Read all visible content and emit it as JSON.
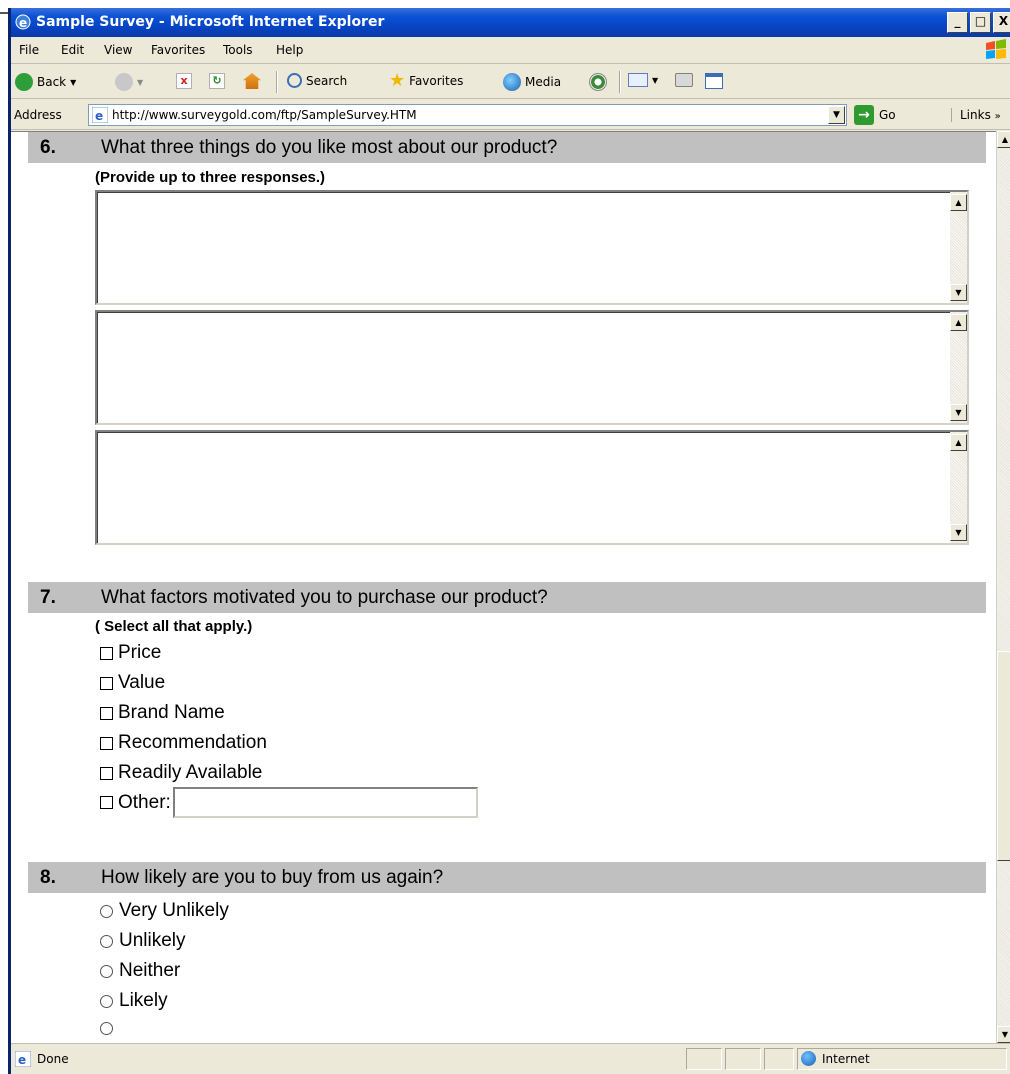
{
  "window": {
    "title": "Sample Survey - Microsoft Internet Explorer",
    "minimize": "_",
    "restore": "□",
    "close": "X"
  },
  "menu": [
    "File",
    "Edit",
    "View",
    "Favorites",
    "Tools",
    "Help"
  ],
  "toolbar": {
    "back": "Back",
    "search": "Search",
    "favorites": "Favorites",
    "media": "Media"
  },
  "address": {
    "label": "Address",
    "url": "http://www.surveygold.com/ftp/SampleSurvey.HTM",
    "go": "Go",
    "links": "Links"
  },
  "survey": {
    "q6": {
      "number": "6.",
      "text": "What three things do you like most about our product?",
      "hint": "(Provide up to three responses.)"
    },
    "q7": {
      "number": "7.",
      "text": "What factors motivated you to purchase our product?",
      "hint": "( Select all that apply.)",
      "options": [
        "Price",
        "Value",
        "Brand Name",
        "Recommendation",
        "Readily Available",
        "Other:"
      ]
    },
    "q8": {
      "number": "8.",
      "text": "How likely are you to buy from us again?",
      "options": [
        "Very Unlikely",
        "Unlikely",
        "Neither",
        "Likely"
      ]
    }
  },
  "status": {
    "text": "Done",
    "zone": "Internet"
  },
  "colors": {
    "titlebar": "#0a51d6",
    "question_band": "#c0c0c0",
    "chrome": "#ece9d8"
  }
}
